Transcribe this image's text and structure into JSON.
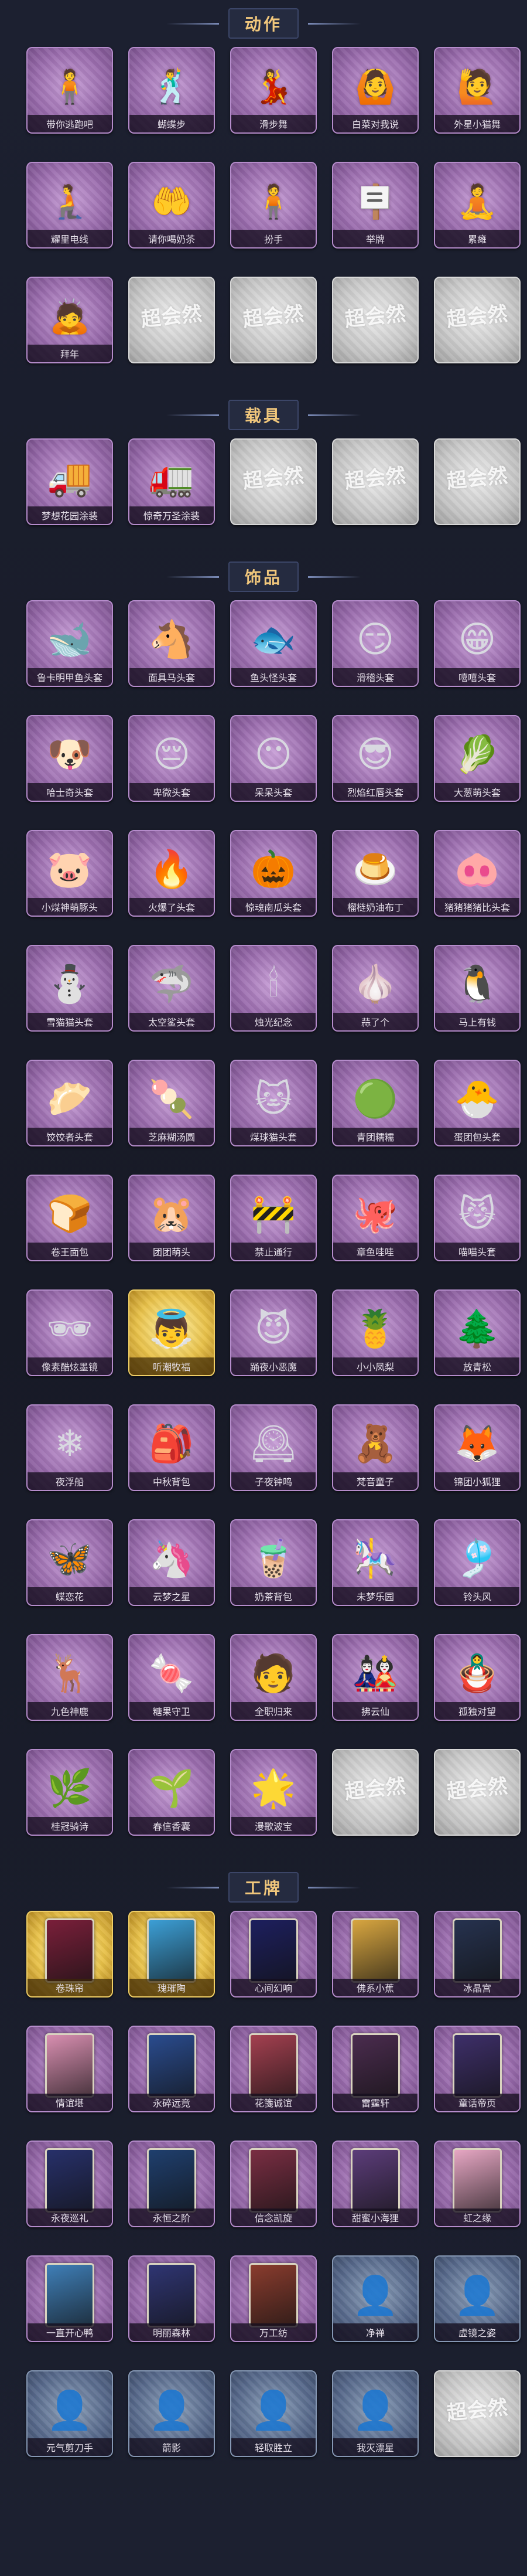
{
  "watermark_text": "超会然",
  "sections": [
    {
      "title": "动作",
      "items": [
        {
          "label": "带你逃跑吧",
          "style": "purple",
          "icon": "🧍"
        },
        {
          "label": "蝴蝶步",
          "style": "purple",
          "icon": "🕺"
        },
        {
          "label": "滑步舞",
          "style": "purple",
          "icon": "💃"
        },
        {
          "label": "白菜对我说",
          "style": "purple",
          "icon": "🙆"
        },
        {
          "label": "外星小猫舞",
          "style": "purple",
          "icon": "🙋"
        },
        {
          "label": "耀里电线",
          "style": "purple",
          "icon": "🧎"
        },
        {
          "label": "请你喝奶茶",
          "style": "purple",
          "icon": "🤲"
        },
        {
          "label": "扮手",
          "style": "purple",
          "icon": "🧍"
        },
        {
          "label": "举牌",
          "style": "purple",
          "icon": "🪧"
        },
        {
          "label": "累瘫",
          "style": "purple",
          "icon": "🧘"
        },
        {
          "label": "拜年",
          "style": "purple",
          "icon": "🙇"
        },
        {
          "label": "",
          "style": "gray",
          "icon": ""
        },
        {
          "label": "",
          "style": "gray",
          "icon": ""
        },
        {
          "label": "",
          "style": "gray",
          "icon": ""
        },
        {
          "label": "",
          "style": "gray",
          "icon": ""
        }
      ]
    },
    {
      "title": "载具",
      "items": [
        {
          "label": "梦想花园涂装",
          "style": "purple",
          "icon": "🚚"
        },
        {
          "label": "惊奇万圣涂装",
          "style": "purple",
          "icon": "🚛"
        },
        {
          "label": "",
          "style": "gray",
          "icon": ""
        },
        {
          "label": "",
          "style": "gray",
          "icon": ""
        },
        {
          "label": "",
          "style": "gray",
          "icon": ""
        }
      ]
    },
    {
      "title": "饰品",
      "items": [
        {
          "label": "鲁卡明甲鱼头套",
          "style": "purple",
          "icon": "🐋"
        },
        {
          "label": "面具马头套",
          "style": "purple",
          "icon": "🐴"
        },
        {
          "label": "鱼头怪头套",
          "style": "purple",
          "icon": "🐟"
        },
        {
          "label": "滑稽头套",
          "style": "purple",
          "icon": "😏"
        },
        {
          "label": "嘻嘻头套",
          "style": "purple",
          "icon": "😁"
        },
        {
          "label": "哈士奇头套",
          "style": "purple",
          "icon": "🐶"
        },
        {
          "label": "卑微头套",
          "style": "purple",
          "icon": "😔"
        },
        {
          "label": "呆呆头套",
          "style": "purple",
          "icon": "😶"
        },
        {
          "label": "烈焰红唇头套",
          "style": "purple",
          "icon": "😎"
        },
        {
          "label": "大葱萌头套",
          "style": "purple",
          "icon": "🥬"
        },
        {
          "label": "小煤神萌豚头",
          "style": "purple",
          "icon": "🐷"
        },
        {
          "label": "火爆了头套",
          "style": "purple",
          "icon": "🔥"
        },
        {
          "label": "惊魂南瓜头套",
          "style": "purple",
          "icon": "🎃"
        },
        {
          "label": "榴梿奶油布丁",
          "style": "purple",
          "icon": "🍮"
        },
        {
          "label": "猪猪猪猪比头套",
          "style": "purple",
          "icon": "🐽"
        },
        {
          "label": "雪猫猫头套",
          "style": "purple",
          "icon": "⛄"
        },
        {
          "label": "太空鲨头套",
          "style": "purple",
          "icon": "🦈"
        },
        {
          "label": "烛光纪念",
          "style": "purple",
          "icon": "🕯"
        },
        {
          "label": "蒜了个",
          "style": "purple",
          "icon": "🧄"
        },
        {
          "label": "马上有钱",
          "style": "purple",
          "icon": "🐧"
        },
        {
          "label": "饺饺者头套",
          "style": "purple",
          "icon": "🥟"
        },
        {
          "label": "芝麻糊汤圆",
          "style": "purple",
          "icon": "🍡"
        },
        {
          "label": "煤球猫头套",
          "style": "purple",
          "icon": "🐱"
        },
        {
          "label": "青团糯糯",
          "style": "purple",
          "icon": "🟢"
        },
        {
          "label": "蛋团包头套",
          "style": "purple",
          "icon": "🐣"
        },
        {
          "label": "卷王面包",
          "style": "purple",
          "icon": "🍞"
        },
        {
          "label": "团团萌头",
          "style": "purple",
          "icon": "🐹"
        },
        {
          "label": "禁止通行",
          "style": "purple",
          "icon": "🚧"
        },
        {
          "label": "章鱼哇哇",
          "style": "purple",
          "icon": "🐙"
        },
        {
          "label": "喵喵头套",
          "style": "purple",
          "icon": "😼"
        },
        {
          "label": "像素酷炫墨镜",
          "style": "purple",
          "icon": "🕶"
        },
        {
          "label": "听潮牧福",
          "style": "gold",
          "icon": "👼"
        },
        {
          "label": "踊夜小恶魔",
          "style": "purple",
          "icon": "😈"
        },
        {
          "label": "小小凤梨",
          "style": "purple",
          "icon": "🍍"
        },
        {
          "label": "放青松",
          "style": "purple",
          "icon": "🌲"
        },
        {
          "label": "夜浮船",
          "style": "purple",
          "icon": "❄"
        },
        {
          "label": "中秋背包",
          "style": "purple",
          "icon": "🎒"
        },
        {
          "label": "子夜钟鸣",
          "style": "purple",
          "icon": "🕰"
        },
        {
          "label": "梵音童子",
          "style": "purple",
          "icon": "🧸"
        },
        {
          "label": "锦团小狐狸",
          "style": "purple",
          "icon": "🦊"
        },
        {
          "label": "蝶恋花",
          "style": "purple",
          "icon": "🦋"
        },
        {
          "label": "云梦之星",
          "style": "purple",
          "icon": "🦄"
        },
        {
          "label": "奶茶背包",
          "style": "purple",
          "icon": "🧋"
        },
        {
          "label": "未梦乐园",
          "style": "purple",
          "icon": "🎠"
        },
        {
          "label": "铃头风",
          "style": "purple",
          "icon": "🎐"
        },
        {
          "label": "九色神鹿",
          "style": "purple",
          "icon": "🦌"
        },
        {
          "label": "糖果守卫",
          "style": "purple",
          "icon": "🍬"
        },
        {
          "label": "全职归来",
          "style": "purple",
          "icon": "🧑"
        },
        {
          "label": "拂云仙",
          "style": "purple",
          "icon": "🎎"
        },
        {
          "label": "孤独对望",
          "style": "purple",
          "icon": "🪆"
        },
        {
          "label": "桂冠骑诗",
          "style": "purple",
          "icon": "🌿"
        },
        {
          "label": "春信香囊",
          "style": "purple",
          "icon": "🌱"
        },
        {
          "label": "漫歌波宝",
          "style": "purple",
          "icon": "🌟"
        },
        {
          "label": "",
          "style": "gray",
          "icon": ""
        },
        {
          "label": "",
          "style": "gray",
          "icon": ""
        }
      ]
    },
    {
      "title": "工牌",
      "items": [
        {
          "label": "卷珠帘",
          "style": "gold",
          "icon": "card",
          "card_color": "#7a1f3a"
        },
        {
          "label": "瑰璀陶",
          "style": "gold",
          "icon": "card",
          "card_color": "#3c9fd6"
        },
        {
          "label": "心间幻响",
          "style": "purple",
          "icon": "card",
          "card_color": "#1d1f5e"
        },
        {
          "label": "佛系小蕉",
          "style": "purple",
          "icon": "card",
          "card_color": "#d8a640"
        },
        {
          "label": "冰晶宫",
          "style": "purple",
          "icon": "card",
          "card_color": "#26324f"
        },
        {
          "label": "情谊堪",
          "style": "purple",
          "icon": "card",
          "card_color": "#d98fb1"
        },
        {
          "label": "永碎远竟",
          "style": "purple",
          "icon": "card",
          "card_color": "#2a4c8f"
        },
        {
          "label": "花箋诚谊",
          "style": "purple",
          "icon": "card",
          "card_color": "#a44050"
        },
        {
          "label": "雷霆轩",
          "style": "purple",
          "icon": "card",
          "card_color": "#4b2c4f"
        },
        {
          "label": "童话帝页",
          "style": "purple",
          "icon": "card",
          "card_color": "#3e2f6a"
        },
        {
          "label": "永夜巡礼",
          "style": "purple",
          "icon": "card",
          "card_color": "#27306a"
        },
        {
          "label": "永恒之阶",
          "style": "purple",
          "icon": "card",
          "card_color": "#1f3f6e"
        },
        {
          "label": "信念凯旋",
          "style": "purple",
          "icon": "card",
          "card_color": "#7a2e43"
        },
        {
          "label": "甜蜜小海狸",
          "style": "purple",
          "icon": "card",
          "card_color": "#5c3d7a"
        },
        {
          "label": "虹之缘",
          "style": "purple",
          "icon": "card",
          "card_color": "#e7a7c4"
        },
        {
          "label": "一直开心鸭",
          "style": "purple",
          "icon": "card",
          "card_color": "#3f7fb8"
        },
        {
          "label": "明丽森林",
          "style": "purple",
          "icon": "card",
          "card_color": "#2f3573"
        },
        {
          "label": "万工纺",
          "style": "purple",
          "icon": "card",
          "card_color": "#8a3c2e"
        },
        {
          "label": "净禅",
          "style": "blue",
          "icon": "silhouette"
        },
        {
          "label": "虚镜之姿",
          "style": "blue",
          "icon": "silhouette"
        },
        {
          "label": "元气剪刀手",
          "style": "blue",
          "icon": "silhouette"
        },
        {
          "label": "箭影",
          "style": "blue",
          "icon": "silhouette"
        },
        {
          "label": "轻取胜立",
          "style": "blue",
          "icon": "silhouette"
        },
        {
          "label": "我灭漂星",
          "style": "blue",
          "icon": "silhouette"
        },
        {
          "label": "",
          "style": "gray",
          "icon": ""
        }
      ]
    }
  ]
}
